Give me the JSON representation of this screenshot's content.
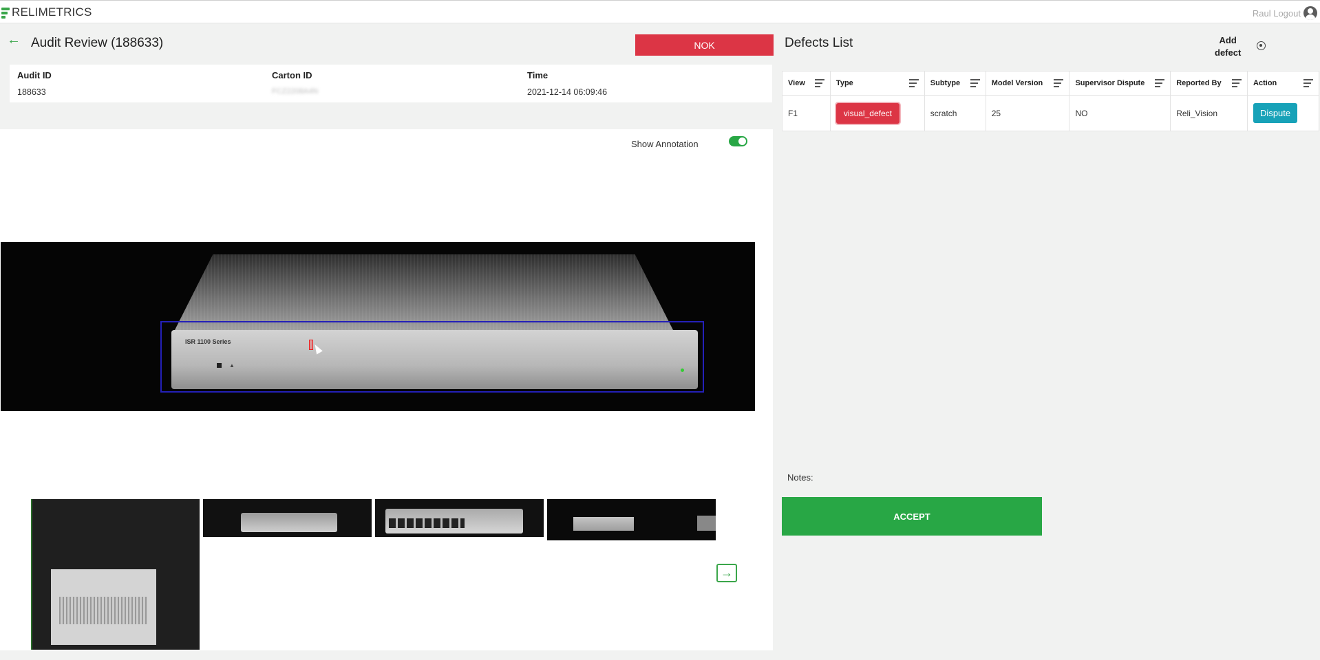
{
  "app": {
    "logo_text": "RELIMETRICS"
  },
  "user": {
    "label": "Raul Logout"
  },
  "header": {
    "back_arrow": "←",
    "title": "Audit Review (188633)",
    "status": "NOK",
    "status_color": "#dc3545"
  },
  "info": {
    "audit_id_label": "Audit ID",
    "audit_id": "188633",
    "carton_id_label": "Carton ID",
    "carton_id": "FCZ2208A4N",
    "time_label": "Time",
    "time": "2021-12-14 06:09:46"
  },
  "viewer": {
    "show_annotation_label": "Show Annotation",
    "show_annotation": true,
    "device_label": "ISR 1100 Series",
    "next_arrow": "→"
  },
  "defects": {
    "title": "Defects List",
    "add_label_line1": "Add",
    "add_label_line2": "defect",
    "columns": [
      "View",
      "Type",
      "Subtype",
      "Model Version",
      "Supervisor Dispute",
      "Reported By",
      "Action"
    ],
    "rows": [
      {
        "view": "F1",
        "type": "visual_defect",
        "subtype": "scratch",
        "model_version": "25",
        "supervisor_dispute": "NO",
        "reported_by": "Reli_Vision",
        "action": "Dispute"
      }
    ]
  },
  "notes": {
    "label": "Notes:"
  },
  "accept": {
    "label": "ACCEPT",
    "color": "#28a745"
  }
}
